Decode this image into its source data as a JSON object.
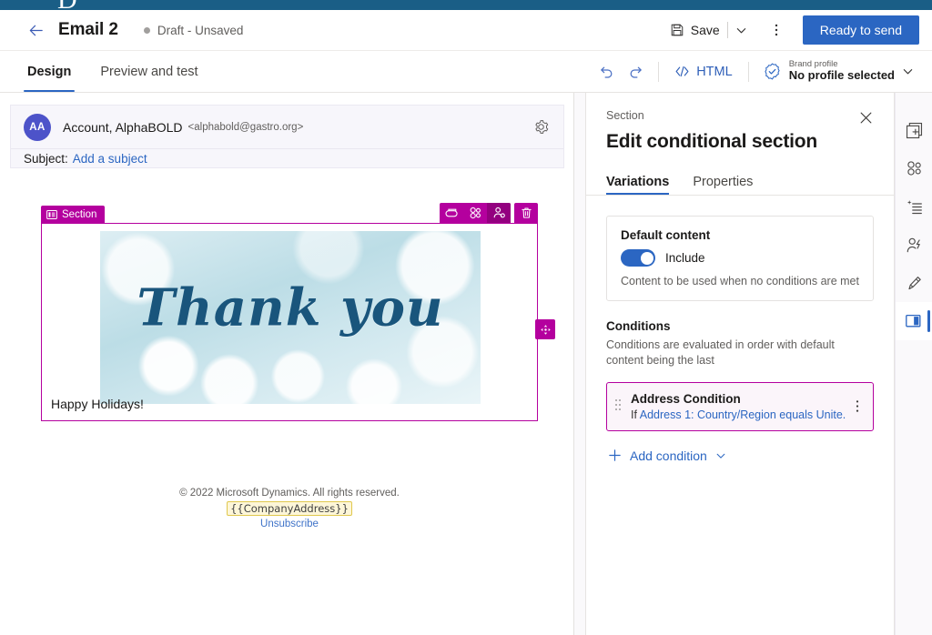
{
  "brand": {
    "strip_color": "#1a5e86",
    "glyph": "D"
  },
  "command_bar": {
    "back_icon": "arrow-left-icon",
    "title": "Email 2",
    "status": "Draft - Unsaved",
    "save_label": "Save",
    "save_icon": "save-disk-icon",
    "save_chevron_icon": "chevron-down-icon",
    "overflow_icon": "more-vertical-icon",
    "primary_button": "Ready to send"
  },
  "tab_bar": {
    "tabs": [
      {
        "label": "Design",
        "active": true
      },
      {
        "label": "Preview and test",
        "active": false
      }
    ],
    "undo_icon": "undo-icon",
    "redo_icon": "redo-icon",
    "html_label": "HTML",
    "html_icon": "code-icon",
    "brand_icon": "brand-badge-icon",
    "brand_profile_label": "Brand profile",
    "brand_profile_value": "No profile selected",
    "brand_chevron_icon": "chevron-down-icon"
  },
  "email": {
    "avatar_initials": "AA",
    "sender_name": "Account, AlphaBOLD",
    "sender_email": "<alphabold@gastro.org>",
    "settings_icon": "gear-icon",
    "subject_label": "Subject:",
    "subject_placeholder": "Add a subject",
    "section": {
      "label": "Section",
      "label_icon": "section-layout-icon",
      "tools": [
        {
          "name": "conditional-content-icon",
          "selected": false
        },
        {
          "name": "styles-icon",
          "selected": false
        },
        {
          "name": "audience-personalize-icon",
          "selected": true
        },
        {
          "name": "delete-icon",
          "selected": false
        }
      ],
      "drag_handle_icon": "move-arrows-icon",
      "hero_text": "Thank you",
      "body_text": "Happy Holidays!"
    },
    "footer": {
      "copyright": "© 2022 Microsoft Dynamics. All rights reserved.",
      "token": "{{CompanyAddress}}",
      "unsubscribe": "Unsubscribe"
    }
  },
  "panel": {
    "eyebrow": "Section",
    "title": "Edit conditional section",
    "close_icon": "close-icon",
    "tabs": [
      {
        "label": "Variations",
        "active": true
      },
      {
        "label": "Properties",
        "active": false
      }
    ],
    "default_content": {
      "title": "Default content",
      "toggle_on": true,
      "toggle_label": "Include",
      "hint": "Content to be used when no conditions are met"
    },
    "conditions": {
      "heading": "Conditions",
      "hint": "Conditions are evaluated in order with default content being the last",
      "items": [
        {
          "title": "Address Condition",
          "if_prefix": "If ",
          "expression": "Address 1: Country/Region equals Unite...",
          "drag_icon": "drag-dots-icon",
          "more_icon": "more-vertical-icon"
        }
      ],
      "add_label": "Add condition",
      "add_icon": "plus-icon",
      "add_chevron_icon": "chevron-down-icon"
    },
    "accent_color": "#b4009e",
    "link_color": "#2b66c2"
  },
  "rail": {
    "items": [
      {
        "name": "add-element-icon",
        "active": false
      },
      {
        "name": "styles-icon",
        "active": false
      },
      {
        "name": "ai-content-icon",
        "active": false
      },
      {
        "name": "personalize-user-icon",
        "active": false
      },
      {
        "name": "brush-theme-icon",
        "active": false
      },
      {
        "name": "layout-panel-icon",
        "active": true
      }
    ]
  }
}
